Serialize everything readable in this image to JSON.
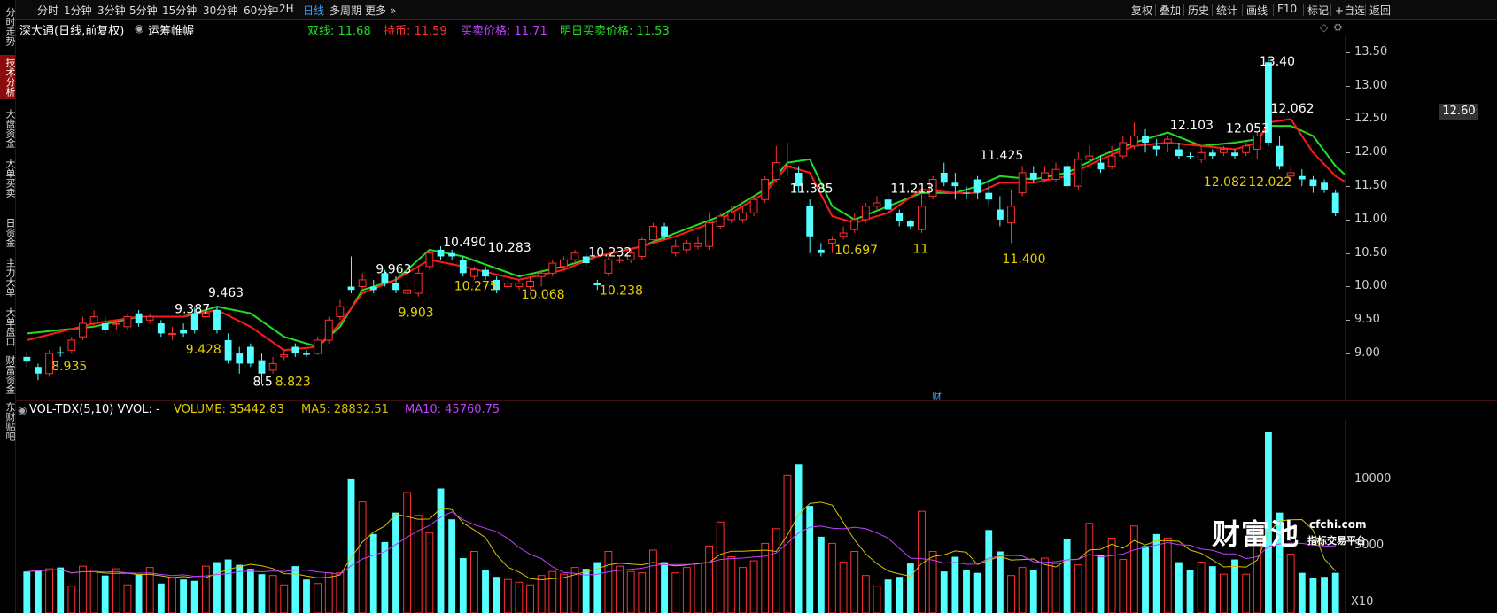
{
  "sidebar": [
    {
      "label": "分时走势",
      "active": false
    },
    {
      "label": "技术分析",
      "active": true
    },
    {
      "label": "大盘资金",
      "active": false
    },
    {
      "label": "大单买卖",
      "active": false
    },
    {
      "label": "一日资金",
      "active": false
    },
    {
      "label": "主力大单",
      "active": false
    },
    {
      "label": "大单盘口",
      "active": false
    },
    {
      "label": "财富资金",
      "active": false
    },
    {
      "label": "东财贴吧",
      "active": false
    }
  ],
  "periods": [
    "分时",
    "1分钟",
    "3分钟",
    "5分钟",
    "15分钟",
    "30分钟",
    "60分钟",
    "2H",
    "日线",
    "多周期",
    "更多"
  ],
  "active_period": "日线",
  "tools": [
    "复权",
    "叠加",
    "历史",
    "统计",
    "画线",
    "F10",
    "标记",
    "+自选",
    "返回"
  ],
  "info": {
    "stock": "深大通(日线,前复权)",
    "indicator": "运筹帷幄",
    "shuangxian": "双线: 11.68",
    "chibi": "持币: 11.59",
    "buysell": "买卖价格: 11.71",
    "tomorrow": "明日买卖价格: 11.53"
  },
  "volume_info": {
    "title": "VOL-TDX(5,10) VVOL: -",
    "volume": "VOLUME: 35442.83",
    "ma5": "MA5: 28832.51",
    "ma10": "MA10: 45760.75"
  },
  "price_axis": [
    "13.50",
    "13.00",
    "12.50",
    "12.00",
    "11.50",
    "11.00",
    "10.50",
    "10.00",
    "9.50",
    "9.00"
  ],
  "current_price": "12.60",
  "volume_axis": [
    "10000",
    "5000"
  ],
  "volume_unit": "X10",
  "marker_cai": "财",
  "watermark": {
    "brand": "财富池",
    "site": "cfchi.com",
    "slogan": "指标交易平台"
  },
  "colors": {
    "up": "#ff3030",
    "down": "#54ffff",
    "ma_red": "#ff1a1a",
    "ma_green": "#22dd22",
    "yellow": "#e8d000",
    "magenta": "#c040ff",
    "volume_ma5": "#d8c000"
  },
  "chart_data": {
    "type": "candlestick",
    "ylim": [
      8.3,
      13.75
    ],
    "candles": [
      [
        8.95,
        8.88,
        9.02,
        8.8,
        "dn"
      ],
      [
        8.8,
        8.7,
        8.85,
        8.6,
        "dn"
      ],
      [
        8.7,
        9.0,
        9.05,
        8.65,
        "up"
      ],
      [
        9.02,
        9.0,
        9.1,
        8.95,
        "dn"
      ],
      [
        9.05,
        9.2,
        9.25,
        9.0,
        "up"
      ],
      [
        9.25,
        9.45,
        9.55,
        9.2,
        "up"
      ],
      [
        9.45,
        9.55,
        9.65,
        9.4,
        "up"
      ],
      [
        9.45,
        9.35,
        9.55,
        9.3,
        "dn"
      ],
      [
        9.45,
        9.45,
        9.5,
        9.35,
        "up"
      ],
      [
        9.4,
        9.55,
        9.6,
        9.35,
        "up"
      ],
      [
        9.6,
        9.45,
        9.65,
        9.4,
        "dn"
      ],
      [
        9.5,
        9.55,
        9.6,
        9.45,
        "up"
      ],
      [
        9.45,
        9.3,
        9.5,
        9.25,
        "dn"
      ],
      [
        9.3,
        9.3,
        9.4,
        9.2,
        "up"
      ],
      [
        9.35,
        9.3,
        9.45,
        9.25,
        "dn"
      ],
      [
        9.6,
        9.35,
        9.7,
        9.3,
        "dn"
      ],
      [
        9.55,
        9.6,
        9.7,
        9.45,
        "up"
      ],
      [
        9.65,
        9.35,
        9.7,
        9.3,
        "dn"
      ],
      [
        9.2,
        8.9,
        9.3,
        8.85,
        "dn"
      ],
      [
        9.0,
        8.85,
        9.1,
        8.7,
        "dn"
      ],
      [
        9.1,
        8.85,
        9.15,
        8.8,
        "dn"
      ],
      [
        8.9,
        8.7,
        9.0,
        8.55,
        "dn"
      ],
      [
        8.75,
        8.85,
        8.95,
        8.7,
        "up"
      ],
      [
        8.95,
        8.98,
        9.05,
        8.9,
        "up"
      ],
      [
        9.1,
        9.0,
        9.15,
        8.95,
        "dn"
      ],
      [
        9.0,
        8.98,
        9.05,
        8.95,
        "dn"
      ],
      [
        9.0,
        9.2,
        9.25,
        8.98,
        "up"
      ],
      [
        9.2,
        9.5,
        9.55,
        9.15,
        "up"
      ],
      [
        9.55,
        9.7,
        9.8,
        9.5,
        "up"
      ],
      [
        10.0,
        9.95,
        10.45,
        9.9,
        "dn"
      ],
      [
        10.0,
        10.1,
        10.2,
        9.95,
        "up"
      ],
      [
        10.0,
        9.95,
        10.1,
        9.9,
        "dn"
      ],
      [
        10.2,
        10.05,
        10.25,
        10.0,
        "dn"
      ],
      [
        10.05,
        9.95,
        10.15,
        9.9,
        "dn"
      ],
      [
        9.9,
        9.95,
        10.05,
        9.85,
        "up"
      ],
      [
        9.9,
        10.2,
        10.3,
        9.85,
        "up"
      ],
      [
        10.3,
        10.5,
        10.55,
        10.25,
        "up"
      ],
      [
        10.55,
        10.45,
        10.6,
        10.4,
        "dn"
      ],
      [
        10.45,
        10.5,
        10.55,
        10.4,
        "dn"
      ],
      [
        10.4,
        10.2,
        10.45,
        10.15,
        "dn"
      ],
      [
        10.25,
        10.15,
        10.3,
        10.1,
        "up"
      ],
      [
        10.25,
        10.15,
        10.3,
        10.1,
        "dn"
      ],
      [
        10.1,
        9.95,
        10.15,
        9.9,
        "dn"
      ],
      [
        10.0,
        10.05,
        10.1,
        9.95,
        "up"
      ],
      [
        10.0,
        10.05,
        10.1,
        9.95,
        "up"
      ],
      [
        10.0,
        10.08,
        10.15,
        9.95,
        "up"
      ],
      [
        10.15,
        10.2,
        10.25,
        10.0,
        "up"
      ],
      [
        10.2,
        10.35,
        10.4,
        10.15,
        "up"
      ],
      [
        10.3,
        10.4,
        10.45,
        10.25,
        "up"
      ],
      [
        10.4,
        10.5,
        10.55,
        10.35,
        "up"
      ],
      [
        10.45,
        10.35,
        10.5,
        10.3,
        "dn"
      ],
      [
        10.05,
        10.02,
        10.1,
        9.95,
        "dn"
      ],
      [
        10.2,
        10.4,
        10.45,
        10.15,
        "up"
      ],
      [
        10.4,
        10.4,
        10.45,
        10.35,
        "up"
      ],
      [
        10.4,
        10.5,
        10.55,
        10.35,
        "up"
      ],
      [
        10.45,
        10.7,
        10.75,
        10.4,
        "up"
      ],
      [
        10.7,
        10.9,
        10.95,
        10.65,
        "up"
      ],
      [
        10.9,
        10.75,
        10.95,
        10.7,
        "dn"
      ],
      [
        10.6,
        10.5,
        10.7,
        10.45,
        "up"
      ],
      [
        10.55,
        10.65,
        10.7,
        10.5,
        "up"
      ],
      [
        10.65,
        10.6,
        10.75,
        10.55,
        "up"
      ],
      [
        10.6,
        10.95,
        11.1,
        10.55,
        "up"
      ],
      [
        10.9,
        11.05,
        11.1,
        10.85,
        "up"
      ],
      [
        11.0,
        11.1,
        11.2,
        10.95,
        "up"
      ],
      [
        11.0,
        11.1,
        11.2,
        10.95,
        "up"
      ],
      [
        11.1,
        11.3,
        11.35,
        11.05,
        "up"
      ],
      [
        11.3,
        11.6,
        11.65,
        11.25,
        "up"
      ],
      [
        11.6,
        11.85,
        12.1,
        11.55,
        "up"
      ],
      [
        11.8,
        11.8,
        12.15,
        11.65,
        "up"
      ],
      [
        11.7,
        11.5,
        11.8,
        11.4,
        "dn"
      ],
      [
        11.2,
        10.75,
        11.3,
        10.5,
        "dn"
      ],
      [
        10.55,
        10.5,
        10.65,
        10.45,
        "dn"
      ],
      [
        10.65,
        10.7,
        10.75,
        10.5,
        "up"
      ],
      [
        10.75,
        10.8,
        10.9,
        10.7,
        "up"
      ],
      [
        10.85,
        11.0,
        11.1,
        10.8,
        "up"
      ],
      [
        11.0,
        11.2,
        11.25,
        10.95,
        "up"
      ],
      [
        11.2,
        11.25,
        11.35,
        11.15,
        "up"
      ],
      [
        11.3,
        11.15,
        11.4,
        11.1,
        "dn"
      ],
      [
        11.1,
        10.98,
        11.15,
        10.9,
        "dn"
      ],
      [
        10.9,
        10.98,
        11.0,
        10.85,
        "dn"
      ],
      [
        10.85,
        11.2,
        11.45,
        10.8,
        "up"
      ],
      [
        11.35,
        11.6,
        11.65,
        11.3,
        "up"
      ],
      [
        11.7,
        11.55,
        11.85,
        11.5,
        "dn"
      ],
      [
        11.55,
        11.5,
        11.7,
        11.3,
        "dn"
      ],
      [
        11.4,
        11.4,
        11.5,
        11.3,
        "dn"
      ],
      [
        11.6,
        11.4,
        11.65,
        11.3,
        "dn"
      ],
      [
        11.4,
        11.3,
        11.6,
        11.2,
        "dn"
      ],
      [
        11.15,
        11.0,
        11.35,
        10.9,
        "dn"
      ],
      [
        10.95,
        11.2,
        11.45,
        10.65,
        "up"
      ],
      [
        11.4,
        11.7,
        11.8,
        11.35,
        "up"
      ],
      [
        11.7,
        11.6,
        11.8,
        11.55,
        "dn"
      ],
      [
        11.6,
        11.7,
        11.8,
        11.55,
        "up"
      ],
      [
        11.6,
        11.75,
        11.85,
        11.55,
        "up"
      ],
      [
        11.8,
        11.5,
        11.85,
        11.45,
        "dn"
      ],
      [
        11.5,
        11.9,
        12.0,
        11.45,
        "up"
      ],
      [
        11.9,
        11.95,
        12.1,
        11.85,
        "up"
      ],
      [
        11.85,
        11.75,
        11.95,
        11.7,
        "dn"
      ],
      [
        11.8,
        11.95,
        12.1,
        11.75,
        "up"
      ],
      [
        11.95,
        12.15,
        12.25,
        11.9,
        "up"
      ],
      [
        12.1,
        12.25,
        12.45,
        12.05,
        "up"
      ],
      [
        12.25,
        12.15,
        12.35,
        12.0,
        "dn"
      ],
      [
        12.1,
        12.05,
        12.2,
        11.95,
        "dn"
      ],
      [
        12.15,
        12.2,
        12.25,
        12.0,
        "up"
      ],
      [
        12.05,
        11.95,
        12.15,
        11.9,
        "dn"
      ],
      [
        11.95,
        11.95,
        12.0,
        11.9,
        "dn"
      ],
      [
        11.9,
        12.0,
        12.1,
        11.85,
        "up"
      ],
      [
        11.95,
        12.0,
        12.05,
        11.9,
        "dn"
      ],
      [
        12.0,
        12.05,
        12.1,
        11.95,
        "up"
      ],
      [
        12.0,
        11.95,
        12.05,
        11.9,
        "dn"
      ],
      [
        12.0,
        12.1,
        12.15,
        11.95,
        "up"
      ],
      [
        12.25,
        12.05,
        12.3,
        11.9,
        "up"
      ],
      [
        12.15,
        13.35,
        13.4,
        12.1,
        "dn"
      ],
      [
        12.1,
        11.8,
        12.25,
        11.75,
        "dn"
      ],
      [
        11.7,
        11.65,
        11.8,
        11.55,
        "up"
      ],
      [
        11.65,
        11.6,
        11.75,
        11.5,
        "dn"
      ],
      [
        11.6,
        11.5,
        11.65,
        11.4,
        "dn"
      ],
      [
        11.55,
        11.45,
        11.6,
        11.4,
        "dn"
      ],
      [
        11.4,
        11.1,
        11.45,
        11.05,
        "dn"
      ]
    ],
    "volume_ylim": [
      0,
      13500
    ],
    "volumes": [
      3100,
      3200,
      3300,
      3400,
      2000,
      3500,
      3200,
      2800,
      3300,
      2100,
      2900,
      3400,
      2200,
      2600,
      2500,
      2400,
      3500,
      3800,
      4000,
      3600,
      3300,
      2900,
      2800,
      2100,
      3500,
      2500,
      2200,
      3000,
      3000,
      10000,
      8300,
      5900,
      5300,
      7500,
      9000,
      7300,
      6000,
      9300,
      7000,
      4100,
      4600,
      3200,
      2700,
      2500,
      2300,
      2100,
      2800,
      3100,
      2900,
      3400,
      3300,
      3800,
      4600,
      3500,
      3100,
      3000,
      4700,
      3800,
      3000,
      3400,
      3700,
      5000,
      6800,
      4200,
      3400,
      3900,
      5200,
      6300,
      10300,
      11100,
      8000,
      5700,
      5200,
      3800,
      4600,
      2800,
      2000,
      2500,
      2700,
      3700,
      7600,
      4600,
      3100,
      4200,
      3200,
      3000,
      6200,
      4600,
      2800,
      3400,
      3200,
      4100,
      3700,
      5500,
      3600,
      6700,
      4300,
      5600,
      4000,
      6500,
      5000,
      5900,
      5600,
      3800,
      3200,
      3800,
      3500,
      2900,
      4000,
      2900,
      6500,
      13500,
      7500,
      4400,
      3000,
      2600,
      2700,
      3000
    ],
    "lines_ma_red": [
      [
        0,
        9.2
      ],
      [
        6,
        9.45
      ],
      [
        10,
        9.55
      ],
      [
        14,
        9.55
      ],
      [
        17,
        9.65
      ],
      [
        20,
        9.4
      ],
      [
        23,
        9.05
      ],
      [
        26,
        9.1
      ],
      [
        28,
        9.45
      ],
      [
        30,
        9.9
      ],
      [
        33,
        10.1
      ],
      [
        36,
        10.4
      ],
      [
        39,
        10.3
      ],
      [
        44,
        10.1
      ],
      [
        48,
        10.25
      ],
      [
        51,
        10.45
      ],
      [
        55,
        10.6
      ],
      [
        58,
        10.75
      ],
      [
        62,
        11.0
      ],
      [
        66,
        11.4
      ],
      [
        68,
        11.8
      ],
      [
        70,
        11.7
      ],
      [
        72,
        11.05
      ],
      [
        74,
        10.95
      ],
      [
        77,
        11.1
      ],
      [
        80,
        11.45
      ],
      [
        83,
        11.4
      ],
      [
        85,
        11.4
      ],
      [
        87,
        11.55
      ],
      [
        90,
        11.55
      ],
      [
        93,
        11.65
      ],
      [
        96,
        11.9
      ],
      [
        99,
        12.1
      ],
      [
        102,
        12.15
      ],
      [
        105,
        12.1
      ],
      [
        108,
        12.05
      ],
      [
        110,
        12.15
      ],
      [
        111,
        12.45
      ],
      [
        113,
        12.5
      ],
      [
        115,
        12.0
      ],
      [
        117,
        11.65
      ],
      [
        118,
        11.55
      ]
    ],
    "lines_ma_green": [
      [
        0,
        9.3
      ],
      [
        6,
        9.4
      ],
      [
        10,
        9.55
      ],
      [
        14,
        9.55
      ],
      [
        17,
        9.7
      ],
      [
        20,
        9.6
      ],
      [
        23,
        9.25
      ],
      [
        26,
        9.1
      ],
      [
        28,
        9.4
      ],
      [
        30,
        9.95
      ],
      [
        33,
        10.1
      ],
      [
        36,
        10.55
      ],
      [
        39,
        10.45
      ],
      [
        44,
        10.15
      ],
      [
        48,
        10.3
      ],
      [
        51,
        10.45
      ],
      [
        55,
        10.6
      ],
      [
        58,
        10.8
      ],
      [
        62,
        11.05
      ],
      [
        66,
        11.45
      ],
      [
        68,
        11.85
      ],
      [
        70,
        11.9
      ],
      [
        72,
        11.2
      ],
      [
        74,
        11.0
      ],
      [
        77,
        11.2
      ],
      [
        80,
        11.4
      ],
      [
        83,
        11.4
      ],
      [
        85,
        11.5
      ],
      [
        87,
        11.65
      ],
      [
        90,
        11.6
      ],
      [
        93,
        11.7
      ],
      [
        96,
        11.95
      ],
      [
        99,
        12.15
      ],
      [
        102,
        12.3
      ],
      [
        105,
        12.1
      ],
      [
        108,
        12.15
      ],
      [
        110,
        12.2
      ],
      [
        111,
        12.4
      ],
      [
        113,
        12.4
      ],
      [
        115,
        12.25
      ],
      [
        117,
        11.8
      ],
      [
        118,
        11.65
      ]
    ],
    "price_labels": [
      {
        "text": "9.387",
        "i": 14,
        "y": 9.6,
        "color": "#ffffff"
      },
      {
        "text": "9.463",
        "i": 17,
        "y": 9.85,
        "color": "#ffffff"
      },
      {
        "text": "8.935",
        "i": 3,
        "y": 8.75,
        "color": "#e8d000"
      },
      {
        "text": "9.428",
        "i": 15,
        "y": 9.0,
        "color": "#e8d000"
      },
      {
        "text": "8.5",
        "i": 21,
        "y": 8.52,
        "color": "#ffffff"
      },
      {
        "text": "8.823",
        "i": 23,
        "y": 8.52,
        "color": "#e8d000"
      },
      {
        "text": "9.963",
        "i": 32,
        "y": 10.2,
        "color": "#ffffff"
      },
      {
        "text": "9.903",
        "i": 34,
        "y": 9.55,
        "color": "#e8d000"
      },
      {
        "text": "10.490",
        "i": 38,
        "y": 10.6,
        "color": "#ffffff"
      },
      {
        "text": "10.283",
        "i": 42,
        "y": 10.52,
        "color": "#ffffff"
      },
      {
        "text": "10.275",
        "i": 39,
        "y": 9.95,
        "color": "#e8d000"
      },
      {
        "text": "10.068",
        "i": 45,
        "y": 9.82,
        "color": "#e8d000"
      },
      {
        "text": "10.232",
        "i": 51,
        "y": 10.45,
        "color": "#ffffff"
      },
      {
        "text": "10.238",
        "i": 52,
        "y": 9.88,
        "color": "#e8d000"
      },
      {
        "text": "11.385",
        "i": 69,
        "y": 11.4,
        "color": "#ffffff"
      },
      {
        "text": "10.697",
        "i": 73,
        "y": 10.48,
        "color": "#e8d000"
      },
      {
        "text": "11.213",
        "i": 78,
        "y": 11.4,
        "color": "#ffffff"
      },
      {
        "text": "11",
        "i": 80,
        "y": 10.5,
        "color": "#e8d000"
      },
      {
        "text": "11.425",
        "i": 86,
        "y": 11.9,
        "color": "#ffffff"
      },
      {
        "text": "11.400",
        "i": 88,
        "y": 10.35,
        "color": "#e8d000"
      },
      {
        "text": "12.103",
        "i": 103,
        "y": 12.35,
        "color": "#ffffff"
      },
      {
        "text": "12.053",
        "i": 108,
        "y": 12.3,
        "color": "#ffffff"
      },
      {
        "text": "12.062",
        "i": 112,
        "y": 12.6,
        "color": "#ffffff"
      },
      {
        "text": "12.082",
        "i": 106,
        "y": 11.5,
        "color": "#e8d000"
      },
      {
        "text": "12.022",
        "i": 110,
        "y": 11.5,
        "color": "#e8d000"
      },
      {
        "text": "13.40",
        "i": 111,
        "y": 13.3,
        "color": "#ffffff"
      }
    ]
  }
}
